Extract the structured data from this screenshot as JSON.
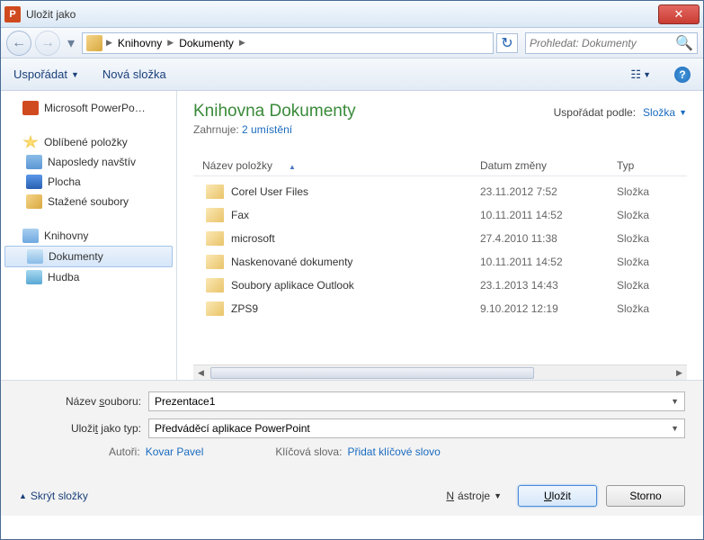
{
  "window": {
    "title": "Uložit jako",
    "app_icon_letter": "P"
  },
  "nav": {
    "crumbs": [
      "Knihovny",
      "Dokumenty"
    ],
    "search_placeholder": "Prohledat: Dokumenty"
  },
  "toolbar": {
    "organize": "Uspořádat",
    "new_folder": "Nová složka"
  },
  "sidebar": {
    "powerpoint": "Microsoft PowerPo…",
    "favorites": "Oblíbené položky",
    "recent": "Naposledy navštív",
    "desktop": "Plocha",
    "downloads": "Stažené soubory",
    "libraries": "Knihovny",
    "documents": "Dokumenty",
    "music": "Hudba"
  },
  "main": {
    "library_title": "Knihovna Dokumenty",
    "includes_label": "Zahrnuje:",
    "includes_link": "2 umístění",
    "sort_label": "Uspořádat podle:",
    "sort_value": "Složka",
    "col_name": "Název položky",
    "col_date": "Datum změny",
    "col_type": "Typ",
    "files": [
      {
        "name": "Corel User Files",
        "date": "23.11.2012 7:52",
        "type": "Složka"
      },
      {
        "name": "Fax",
        "date": "10.11.2011 14:52",
        "type": "Složka"
      },
      {
        "name": "microsoft",
        "date": "27.4.2010 11:38",
        "type": "Složka"
      },
      {
        "name": "Naskenované dokumenty",
        "date": "10.11.2011 14:52",
        "type": "Složka"
      },
      {
        "name": "Soubory aplikace Outlook",
        "date": "23.1.2013 14:43",
        "type": "Složka"
      },
      {
        "name": "ZPS9",
        "date": "9.10.2012 12:19",
        "type": "Složka"
      }
    ]
  },
  "footer": {
    "filename_label": "Název souboru:",
    "filename_value": "Prezentace1",
    "savetype_label": "Uložit jako typ:",
    "savetype_value": "Předváděcí aplikace PowerPoint",
    "authors_label": "Autoři:",
    "authors_value": "Kovar Pavel",
    "keywords_label": "Klíčová slova:",
    "keywords_value": "Přidat klíčové slovo",
    "hide_folders": "Skrýt složky",
    "tools": "Nástroje",
    "save": "Uložit",
    "cancel": "Storno"
  }
}
